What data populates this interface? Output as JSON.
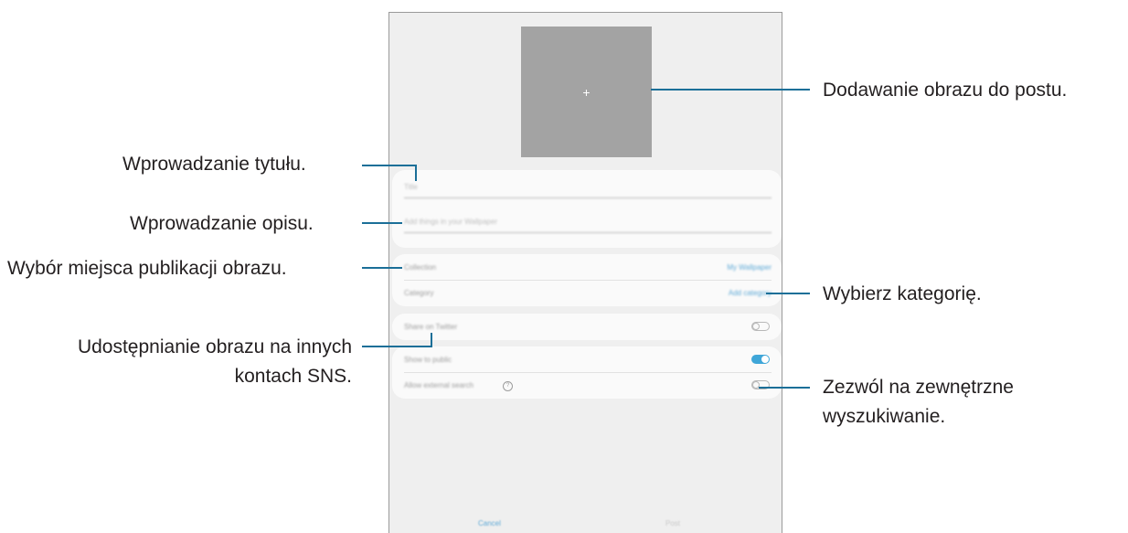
{
  "phone": {
    "image_slot_icon": "+",
    "title_placeholder": "Title",
    "description_placeholder": "Add things in your Wallpaper",
    "collection_label": "Collection",
    "collection_value": "My Wallpaper",
    "category_label": "Category",
    "category_value": "Add category",
    "share_label": "Share on Twitter",
    "public_label": "Show to public",
    "search_label": "Allow external search",
    "share_toggle": "off",
    "public_toggle": "on",
    "search_toggle": "off",
    "cancel_label": "Cancel",
    "post_label": "Post"
  },
  "callouts": {
    "add_image": "Dodawanie obrazu do postu.",
    "title": "Wprowadzanie tytułu.",
    "description": "Wprowadzanie opisu.",
    "publish_place": "Wybór miejsca publikacji obrazu.",
    "category": "Wybierz kategorię.",
    "share_line1": "Udostępnianie obrazu na innych",
    "share_line2": "kontach SNS.",
    "search_line1": "Zezwól na zewnętrzne",
    "search_line2": "wyszukiwanie."
  },
  "colors": {
    "callout_line": "#1b6f98",
    "accent": "#3fa6d8"
  }
}
